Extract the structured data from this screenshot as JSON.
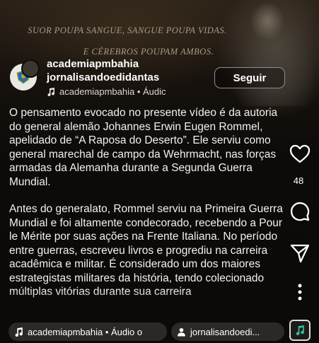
{
  "background_quote": {
    "line1": "SUOR POUPA SANGUE, SANGUE POUPA VIDAS.",
    "line2": "E CÉREBROS POUPAM AMBOS."
  },
  "post": {
    "username_primary": "academiapmbahia",
    "username_secondary": "jornalisandoedidantas",
    "audio_label": "academiapmbahia • Áudic",
    "follow_label": "Seguir"
  },
  "caption": {
    "paragraph1": "O pensamento evocado no presente vídeo é da autoria do general alemão Johannes Erwin Eugen Rommel, apelidado de “A Raposa do Deserto”. Ele serviu como general marechal de campo da Wehrmacht, nas forças armadas da Alemanha durante a Segunda Guerra Mundial.",
    "paragraph2": "Antes do generalato, Rommel serviu na Primeira Guerra Mundial e foi altamente condecorado, recebendo a Pour le Mérite por suas ações na Frente Italiana. No período entre guerras, escreveu livros e progrediu na carreira acadêmica e militar. É considerado um dos maiores estrategistas militares da história, tendo colecionado múltiplas vitórias durante sua carreira"
  },
  "actions": {
    "like_count": "48",
    "icons": [
      "heart-icon",
      "comment-icon",
      "share-icon",
      "more-icon"
    ]
  },
  "bottom_bar": {
    "audio_chip": "academiapmbahia • Áudio o",
    "tag_chip": "jornalisandoedi..."
  },
  "colors": {
    "background": "#0e0c0a",
    "text": "#f1f1f1",
    "chip": "#2b2927",
    "quote": "#a89a86"
  }
}
